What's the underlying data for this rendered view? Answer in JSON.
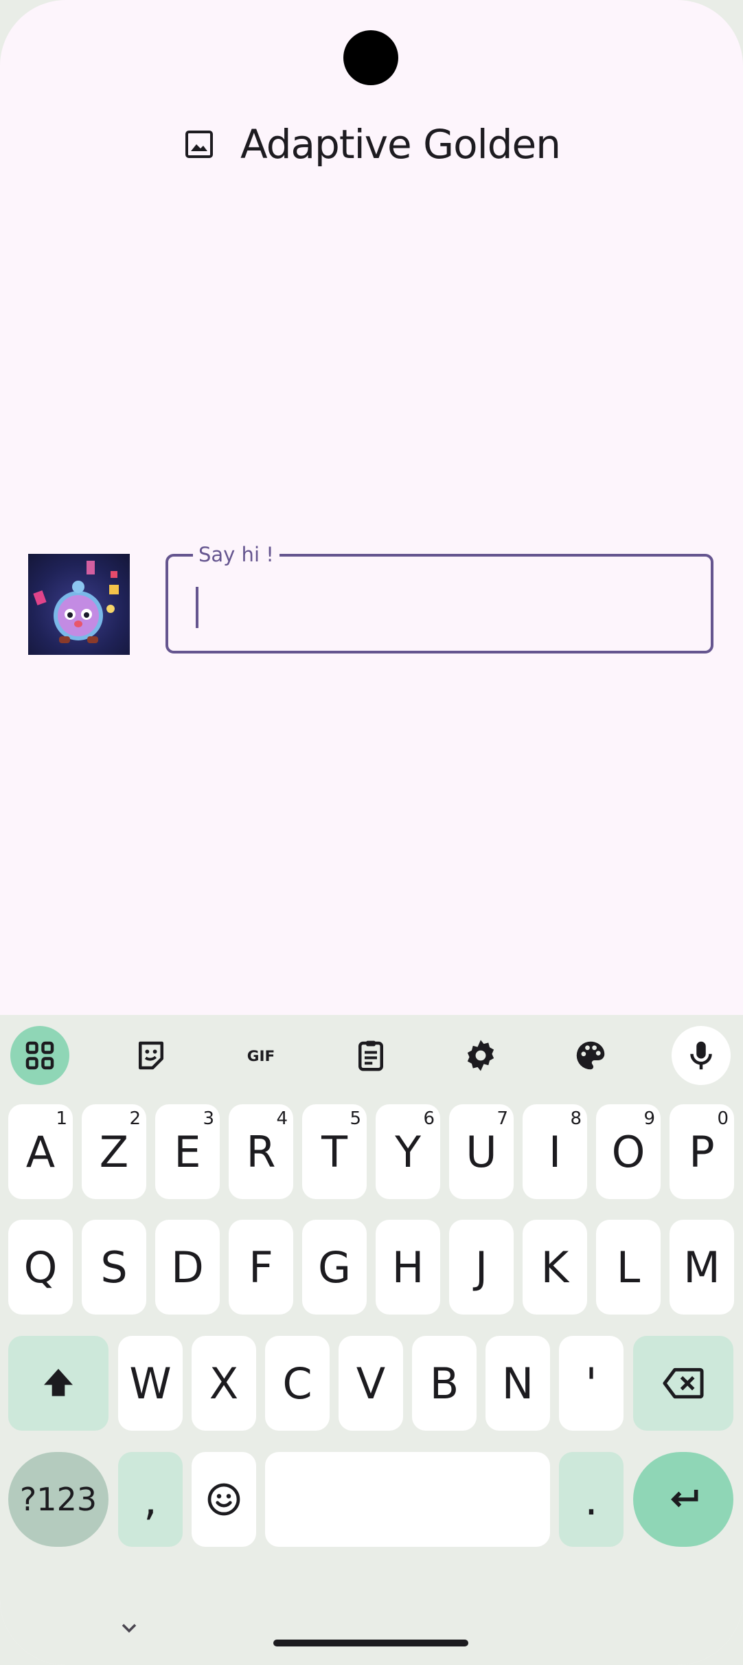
{
  "app": {
    "title": "Adaptive Golden",
    "title_icon": "image-icon"
  },
  "composer": {
    "label": "Say hi !",
    "value": ""
  },
  "keyboard": {
    "toolbar": [
      {
        "name": "apps-grid-icon",
        "label": ""
      },
      {
        "name": "sticker-icon",
        "label": ""
      },
      {
        "name": "gif-button",
        "label": "GIF"
      },
      {
        "name": "clipboard-icon",
        "label": ""
      },
      {
        "name": "settings-icon",
        "label": ""
      },
      {
        "name": "palette-icon",
        "label": ""
      },
      {
        "name": "mic-icon",
        "label": ""
      }
    ],
    "row1": [
      {
        "k": "A",
        "h": "1"
      },
      {
        "k": "Z",
        "h": "2"
      },
      {
        "k": "E",
        "h": "3"
      },
      {
        "k": "R",
        "h": "4"
      },
      {
        "k": "T",
        "h": "5"
      },
      {
        "k": "Y",
        "h": "6"
      },
      {
        "k": "U",
        "h": "7"
      },
      {
        "k": "I",
        "h": "8"
      },
      {
        "k": "O",
        "h": "9"
      },
      {
        "k": "P",
        "h": "0"
      }
    ],
    "row2": [
      "Q",
      "S",
      "D",
      "F",
      "G",
      "H",
      "J",
      "K",
      "L",
      "M"
    ],
    "row3": [
      "W",
      "X",
      "C",
      "V",
      "B",
      "N",
      "'"
    ],
    "symbols_label": "?123",
    "comma": ",",
    "period": ".",
    "accent_color": "#8fd6b6",
    "modifier_color": "#cde8da",
    "symbols_color": "#b4cbbe"
  }
}
